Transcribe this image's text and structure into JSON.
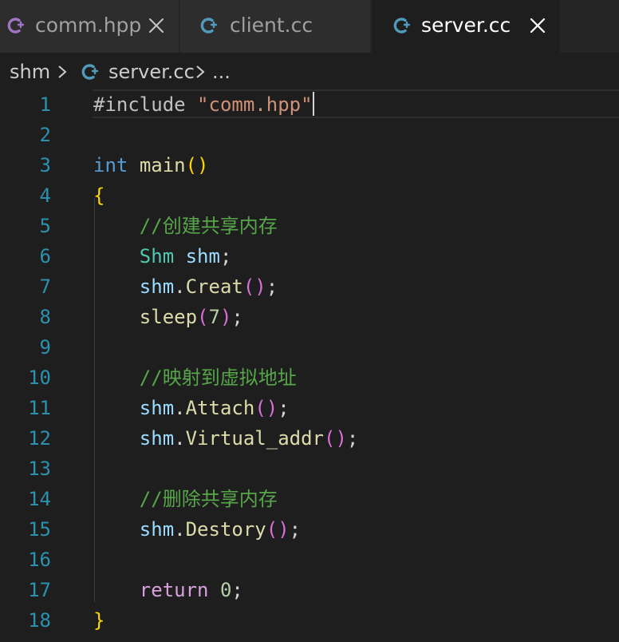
{
  "tabs": [
    {
      "label": "comm.hpp",
      "icon": "cpp-file-icon",
      "active": false,
      "show_close": true
    },
    {
      "label": "client.cc",
      "icon": "cpp-file-icon",
      "active": false,
      "show_close": false
    },
    {
      "label": "server.cc",
      "icon": "cpp-file-icon",
      "active": true,
      "show_close": true
    }
  ],
  "breadcrumb": {
    "folder": "shm",
    "file": "server.cc",
    "tail": "..."
  },
  "colors": {
    "background": "#1e1e1e",
    "tab_inactive": "#2d2d2d",
    "line_number": "#2b91af",
    "keyword": "#569cd6",
    "string": "#ce9178",
    "function": "#dcdcaa",
    "comment": "#57a64a",
    "type": "#4ec9b0",
    "variable": "#9cdcfe",
    "bracket_1": "#ffd700",
    "bracket_2": "#da70d6",
    "cpp_icon": "#a074c4"
  },
  "editor": {
    "current_line": 1,
    "lines": [
      {
        "n": "1",
        "tokens": [
          {
            "t": "#include ",
            "c": "kw-pre"
          },
          {
            "t": "\"comm.hpp\"",
            "c": "str"
          }
        ]
      },
      {
        "n": "2",
        "tokens": []
      },
      {
        "n": "3",
        "tokens": [
          {
            "t": "int",
            "c": "kw"
          },
          {
            "t": " ",
            "c": "pl"
          },
          {
            "t": "main",
            "c": "fn"
          },
          {
            "t": "()",
            "c": "b1"
          }
        ]
      },
      {
        "n": "4",
        "tokens": [
          {
            "t": "{",
            "c": "b1"
          }
        ]
      },
      {
        "n": "5",
        "tokens": [
          {
            "t": "    //创建共享内存",
            "c": "cm"
          }
        ]
      },
      {
        "n": "6",
        "tokens": [
          {
            "t": "    ",
            "c": "pl"
          },
          {
            "t": "Shm",
            "c": "ty"
          },
          {
            "t": " ",
            "c": "pl"
          },
          {
            "t": "shm",
            "c": "var"
          },
          {
            "t": ";",
            "c": "pl"
          }
        ]
      },
      {
        "n": "7",
        "tokens": [
          {
            "t": "    ",
            "c": "pl"
          },
          {
            "t": "shm",
            "c": "var"
          },
          {
            "t": ".",
            "c": "pl"
          },
          {
            "t": "Creat",
            "c": "fn"
          },
          {
            "t": "()",
            "c": "b2"
          },
          {
            "t": ";",
            "c": "pl"
          }
        ]
      },
      {
        "n": "8",
        "tokens": [
          {
            "t": "    ",
            "c": "pl"
          },
          {
            "t": "sleep",
            "c": "fn"
          },
          {
            "t": "(",
            "c": "b2"
          },
          {
            "t": "7",
            "c": "num"
          },
          {
            "t": ")",
            "c": "b2"
          },
          {
            "t": ";",
            "c": "pl"
          }
        ]
      },
      {
        "n": "9",
        "tokens": []
      },
      {
        "n": "10",
        "tokens": [
          {
            "t": "    //映射到虚拟地址",
            "c": "cm"
          }
        ]
      },
      {
        "n": "11",
        "tokens": [
          {
            "t": "    ",
            "c": "pl"
          },
          {
            "t": "shm",
            "c": "var"
          },
          {
            "t": ".",
            "c": "pl"
          },
          {
            "t": "Attach",
            "c": "fn"
          },
          {
            "t": "()",
            "c": "b2"
          },
          {
            "t": ";",
            "c": "pl"
          }
        ]
      },
      {
        "n": "12",
        "tokens": [
          {
            "t": "    ",
            "c": "pl"
          },
          {
            "t": "shm",
            "c": "var"
          },
          {
            "t": ".",
            "c": "pl"
          },
          {
            "t": "Virtual_addr",
            "c": "fn"
          },
          {
            "t": "()",
            "c": "b2"
          },
          {
            "t": ";",
            "c": "pl"
          }
        ]
      },
      {
        "n": "13",
        "tokens": []
      },
      {
        "n": "14",
        "tokens": [
          {
            "t": "    //删除共享内存",
            "c": "cm"
          }
        ]
      },
      {
        "n": "15",
        "tokens": [
          {
            "t": "    ",
            "c": "pl"
          },
          {
            "t": "shm",
            "c": "var"
          },
          {
            "t": ".",
            "c": "pl"
          },
          {
            "t": "Destory",
            "c": "fn"
          },
          {
            "t": "()",
            "c": "b2"
          },
          {
            "t": ";",
            "c": "pl"
          }
        ]
      },
      {
        "n": "16",
        "tokens": []
      },
      {
        "n": "17",
        "tokens": [
          {
            "t": "    ",
            "c": "pl"
          },
          {
            "t": "return",
            "c": "ctl"
          },
          {
            "t": " ",
            "c": "pl"
          },
          {
            "t": "0",
            "c": "num"
          },
          {
            "t": ";",
            "c": "pl"
          }
        ]
      },
      {
        "n": "18",
        "tokens": [
          {
            "t": "}",
            "c": "b1"
          }
        ]
      }
    ]
  }
}
